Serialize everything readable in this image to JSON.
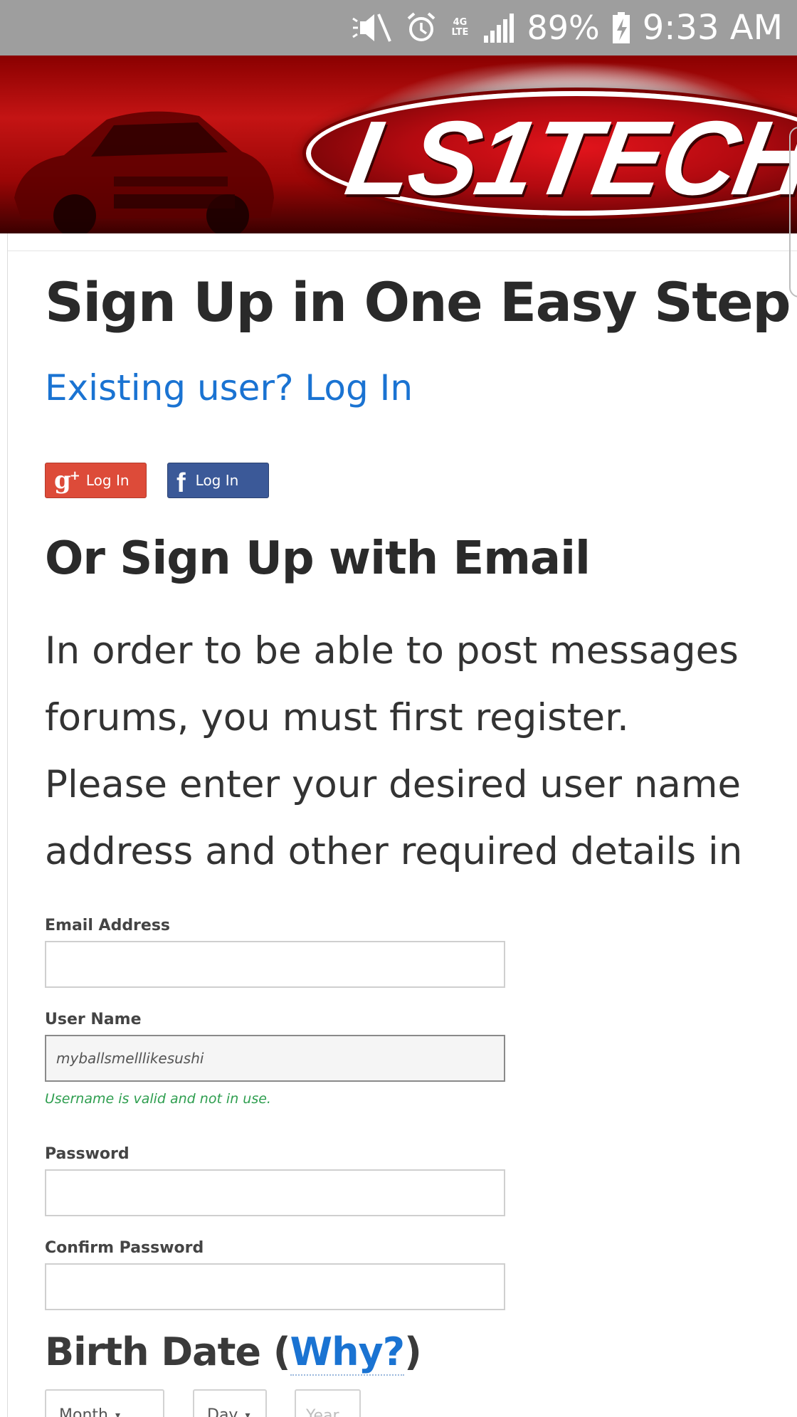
{
  "status_bar": {
    "network": "4G LTE",
    "battery": "89%",
    "time": "9:33 AM"
  },
  "banner": {
    "logo_text": "LS1TECH"
  },
  "page": {
    "title": "Sign Up in One Easy Step",
    "login_link": "Existing user? Log In",
    "google_login_label": "Log In",
    "facebook_login_label": "Log In",
    "section_title": "Or Sign Up with Email",
    "intro_lines": [
      "In order to be able to post messages",
      "forums, you must first register.",
      "Please enter your desired user name",
      "address and other required details in"
    ]
  },
  "form": {
    "email_label": "Email Address",
    "email_value": "",
    "username_label": "User Name",
    "username_value": "myballsmelllikesushi",
    "username_valid_msg": "Username is valid and not in use.",
    "password_label": "Password",
    "password_value": "",
    "confirm_password_label": "Confirm Password",
    "confirm_password_value": "",
    "birth_date_title": "Birth Date (",
    "birth_date_why": "Why?",
    "birth_date_close": ")",
    "month_label": "Month",
    "day_label": "Day",
    "year_placeholder": "Year"
  },
  "colors": {
    "link": "#1a73d2",
    "google": "#dd4b39",
    "facebook": "#3b5998",
    "valid": "#2e9e4f",
    "status_bar": "#9e9e9e"
  },
  "icons": [
    "mute-icon",
    "alarm-icon",
    "network-4g-icon",
    "signal-icon",
    "battery-charging-icon",
    "google-plus-icon",
    "facebook-icon",
    "caret-down-icon"
  ]
}
